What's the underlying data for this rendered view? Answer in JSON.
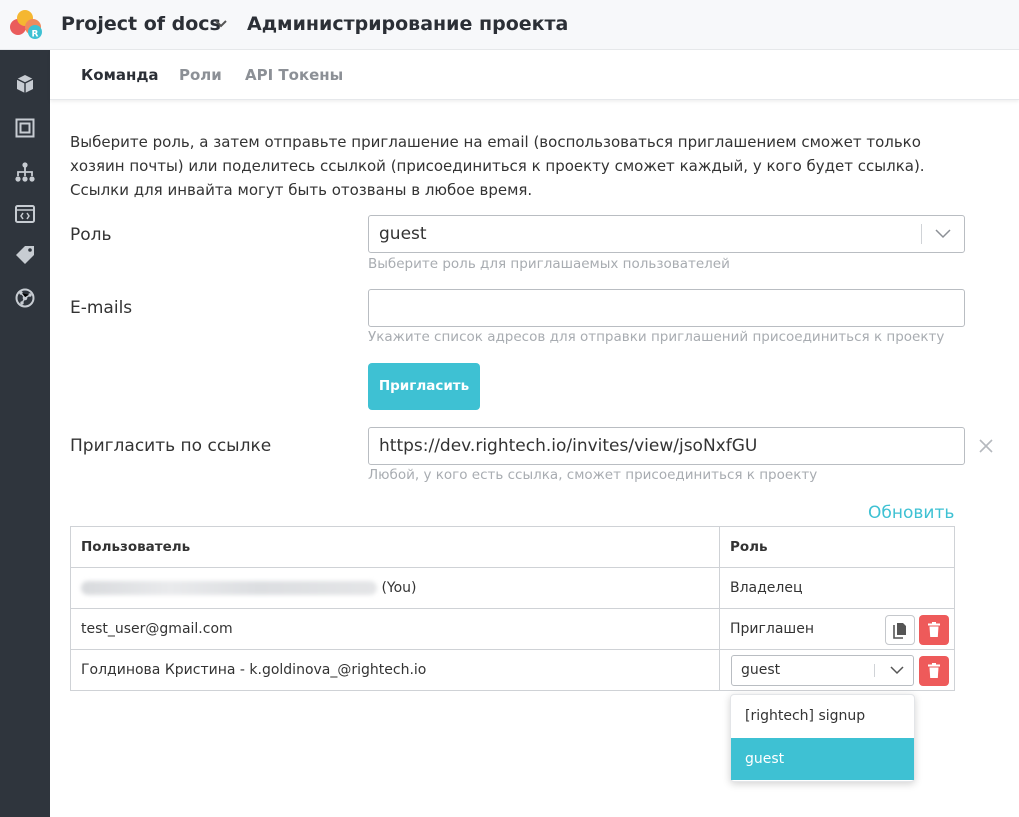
{
  "header": {
    "project_name": "Project of docs",
    "page_title": "Администрирование проекта",
    "brand_colors": [
      "#f5b731",
      "#ea5c5c",
      "#3ec1d3"
    ]
  },
  "sidebar": {
    "items": [
      {
        "icon": "cube-icon"
      },
      {
        "icon": "frame-icon"
      },
      {
        "icon": "hierarchy-icon"
      },
      {
        "icon": "code-icon"
      },
      {
        "icon": "tag-icon"
      },
      {
        "icon": "network-icon"
      }
    ]
  },
  "tabs": [
    {
      "label": "Команда",
      "active": true
    },
    {
      "label": "Роли",
      "active": false
    },
    {
      "label": "API Токены",
      "active": false
    }
  ],
  "intro": {
    "line1": "Выберите роль, а затем отправьте приглашение на email (воспользоваться приглашением сможет только",
    "line2": "хозяин почты) или поделитесь ссылкой (присоединиться к проекту сможет каждый, у кого будет ссылка).",
    "line3": "Ссылки для инвайта могут быть отозваны в любое время."
  },
  "form": {
    "role_label": "Роль",
    "role_value": "guest",
    "role_hint": "Выберите роль для приглашаемых пользователей",
    "emails_label": "E-mails",
    "emails_value": "",
    "emails_hint": "Укажите список адресов для отправки приглашений присоединиться к проекту",
    "invite_button": "Пригласить",
    "link_label": "Пригласить по ссылке",
    "link_value": "https://dev.rightech.io/invites/view/jsoNxfGU",
    "link_hint": "Любой, у кого есть ссылка, сможет присоединиться к проекту"
  },
  "refresh_label": "Обновить",
  "table": {
    "headers": {
      "user": "Пользователь",
      "role": "Роль"
    },
    "rows": [
      {
        "user_suffix": "(You)",
        "role": "Владелец"
      },
      {
        "user": "test_user@gmail.com",
        "role": "Приглашен"
      },
      {
        "user": "Голдинова Кристина - k.goldinova_@rightech.io",
        "role": "guest"
      }
    ]
  },
  "role_dropdown": {
    "options": [
      "[rightech] signup",
      "guest"
    ],
    "selected": "guest"
  },
  "accent_color": "#3ec1d3",
  "danger_color": "#ee5a5a"
}
